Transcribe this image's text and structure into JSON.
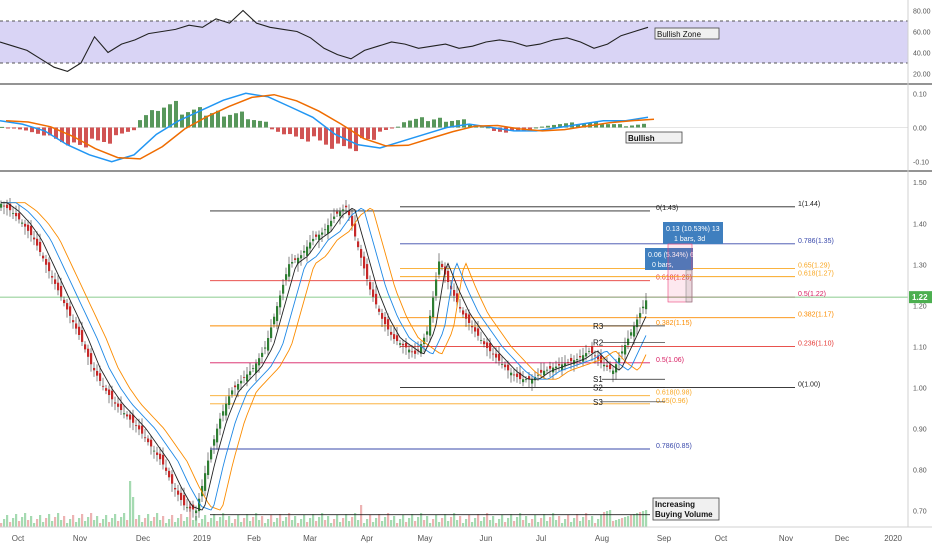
{
  "colors": {
    "candle_up": "#2e7d32",
    "candle_down": "#c62828",
    "rsi_band_fill": "#d9d4f5",
    "macd_line": "#2196f3",
    "signal_line": "#ef6c00",
    "current_price_label_bg": "#4caf50",
    "fib_top": "#212121",
    "fib_0786": "#3949ab",
    "fib_0618": "#f9a825",
    "fib_05": "#d81b60",
    "fib_0382": "#fb8c00",
    "fib_0236": "#e53935",
    "fib_bottom": "#212121",
    "ma_fast": "#222222",
    "ma_mid": "#1e88e5",
    "ma_slow": "#fb8c00",
    "measure_box": "#3f7fbf"
  },
  "rsi_panel": {
    "axis_ticks": [
      "80.00",
      "60.00",
      "40.00",
      "20.00"
    ],
    "annotation": "Bullish Zone"
  },
  "macd_panel": {
    "axis_ticks": [
      "0.10",
      "0.00",
      "-0.10"
    ],
    "annotation": "Bullish"
  },
  "price_panel": {
    "current_price": "1.22",
    "bottom_annotation": "Increasing\nBuying Volume",
    "measure_1": "0.13 (10.53%) 13\n1 bars, 3d",
    "measure_2": "0.06 (5.34%) 6\n0 bars,",
    "pivot_labels": [
      "R3",
      "R2",
      "S1",
      "S2",
      "S3"
    ]
  },
  "chart_data": {
    "type": "candlestick",
    "price_axis": {
      "ticks": [
        "1.50",
        "1.40",
        "1.30",
        "1.20",
        "1.10",
        "1.00",
        "0.90",
        "0.80",
        "0.70"
      ],
      "ylim": [
        0.66,
        1.52
      ]
    },
    "time_axis": {
      "ticks": [
        "Oct",
        "Nov",
        "Dec",
        "2019",
        "Feb",
        "Mar",
        "Apr",
        "May",
        "Jun",
        "Jul",
        "Aug",
        "Sep",
        "Oct",
        "Nov",
        "Dec",
        "2020"
      ]
    },
    "fib_set_large": [
      {
        "label": "0(1.43)",
        "value": 1.43
      },
      {
        "label": "0.786(0.85)",
        "value": 0.85
      }
    ],
    "fib_set_mid": [
      {
        "label": "0.618(1.26)",
        "value": 1.26
      },
      {
        "label": "0.382(1.15)",
        "value": 1.15
      },
      {
        "label": "0.5(1.06)",
        "value": 1.06
      },
      {
        "label": "0.618(0.98)",
        "value": 0.98
      },
      {
        "label": "0.65(0.96)",
        "value": 0.96
      }
    ],
    "fib_set_right": [
      {
        "label": "1(1.44)",
        "value": 1.44
      },
      {
        "label": "0.786(1.35)",
        "value": 1.35
      },
      {
        "label": "0.65(1.29)",
        "value": 1.29
      },
      {
        "label": "0.618(1.27)",
        "value": 1.27
      },
      {
        "label": "0.5(1.22)",
        "value": 1.22
      },
      {
        "label": "0.382(1.17)",
        "value": 1.17
      },
      {
        "label": "0.236(1.10)",
        "value": 1.1
      },
      {
        "label": "0(1.00)",
        "value": 1.0
      }
    ],
    "fib_bottom_line": 0.69,
    "price_path": [
      1.45,
      1.43,
      1.4,
      1.36,
      1.3,
      1.24,
      1.18,
      1.12,
      1.05,
      1.0,
      0.96,
      0.93,
      0.9,
      0.86,
      0.82,
      0.76,
      0.71,
      0.7,
      0.82,
      0.92,
      0.99,
      1.02,
      1.05,
      1.1,
      1.2,
      1.3,
      1.32,
      1.36,
      1.38,
      1.42,
      1.44,
      1.34,
      1.24,
      1.17,
      1.12,
      1.1,
      1.08,
      1.14,
      1.31,
      1.24,
      1.18,
      1.14,
      1.1,
      1.07,
      1.04,
      1.02,
      1.02,
      1.04,
      1.05,
      1.06,
      1.07,
      1.09,
      1.06,
      1.04,
      1.1,
      1.16,
      1.22
    ],
    "rsi": [
      50,
      46,
      42,
      34,
      26,
      22,
      30,
      55,
      40,
      48,
      52,
      58,
      60,
      62,
      66,
      64,
      72,
      68,
      80,
      68,
      64,
      62,
      60,
      54,
      44,
      38,
      34,
      42,
      46,
      50,
      48,
      44,
      46,
      48,
      44,
      46,
      50,
      52,
      50,
      46,
      48,
      52,
      54,
      50,
      44,
      48,
      56,
      60,
      64
    ],
    "macd": [
      0.02,
      0.01,
      -0.01,
      -0.05,
      -0.08,
      -0.1,
      -0.08,
      -0.02,
      0.02,
      0.05,
      0.08,
      0.1,
      0.09,
      0.06,
      0.03,
      -0.02,
      -0.05,
      -0.06,
      -0.04,
      -0.02,
      0.0,
      0.01,
      0.0,
      -0.01,
      -0.01,
      0.0,
      0.01,
      0.02,
      0.02,
      0.03
    ]
  }
}
